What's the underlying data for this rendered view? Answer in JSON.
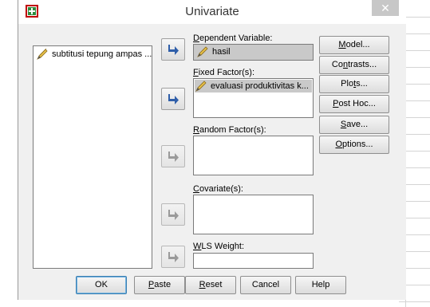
{
  "window": {
    "title": "Univariate",
    "close_glyph": "✕",
    "app_icon": "spss-plus-icon"
  },
  "source_list": {
    "items": [
      {
        "label": "subtitusi tepung  ampas ...",
        "icon": "pencil-icon"
      }
    ]
  },
  "fields": {
    "dependent": {
      "label_pre": "",
      "label_ul": "D",
      "label_post": "ependent Variable:",
      "value": "hasil",
      "icon": "pencil-icon"
    },
    "fixed": {
      "label_pre": "",
      "label_ul": "F",
      "label_post": "ixed Factor(s):",
      "items": [
        {
          "label": "evaluasi produktivitas k...",
          "icon": "pencil-icon"
        }
      ]
    },
    "random": {
      "label_pre": "",
      "label_ul": "R",
      "label_post": "andom Factor(s):"
    },
    "covariate": {
      "label_pre": "",
      "label_ul": "C",
      "label_post": "ovariate(s):"
    },
    "wls": {
      "label_pre": "",
      "label_ul": "W",
      "label_post": "LS Weight:"
    }
  },
  "side_buttons": [
    {
      "pre": "",
      "ul": "M",
      "post": "odel..."
    },
    {
      "pre": "Co",
      "ul": "n",
      "post": "trasts..."
    },
    {
      "pre": "Plo",
      "ul": "t",
      "post": "s..."
    },
    {
      "pre": "",
      "ul": "P",
      "post": "ost Hoc..."
    },
    {
      "pre": "",
      "ul": "S",
      "post": "ave..."
    },
    {
      "pre": "",
      "ul": "O",
      "post": "ptions..."
    }
  ],
  "bottom_buttons": [
    {
      "pre": "OK",
      "ul": "",
      "post": ""
    },
    {
      "pre": "",
      "ul": "P",
      "post": "aste"
    },
    {
      "pre": "",
      "ul": "R",
      "post": "eset"
    },
    {
      "pre": "Cancel",
      "ul": "",
      "post": ""
    },
    {
      "pre": "Help",
      "ul": "",
      "post": ""
    }
  ],
  "colors": {
    "arrow_active": "#2f5ea9",
    "arrow_disabled": "#9a9a9a",
    "titlebar": "#ffffff",
    "dialog_bg": "#f0f0f0"
  }
}
